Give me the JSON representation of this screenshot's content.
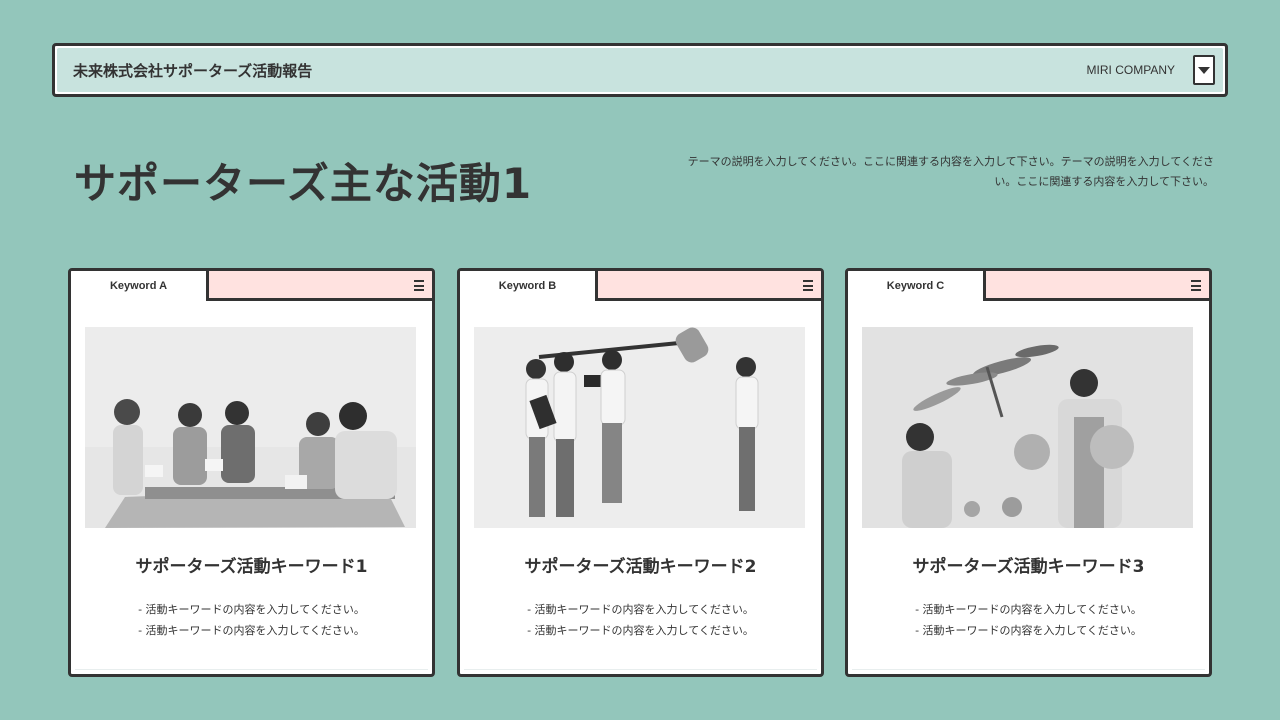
{
  "header": {
    "title": "未来株式会社サポーターズ活動報告",
    "company": "MIRI COMPANY"
  },
  "main": {
    "title": "サポーターズ主な活動1",
    "description": "テーマの説明を入力してください。ここに関連する内容を入力して下さい。テーマの説明を入力してください。ここに関連する内容を入力して下さい。"
  },
  "cards": [
    {
      "tab": "Keyword A",
      "heading": "サポーターズ活動キーワード1",
      "lines": [
        "- 活動キーワードの内容を入力してください。",
        "- 活動キーワードの内容を入力してください。"
      ]
    },
    {
      "tab": "Keyword B",
      "heading": "サポーターズ活動キーワード2",
      "lines": [
        "- 活動キーワードの内容を入力してください。",
        "- 活動キーワードの内容を入力してください。"
      ]
    },
    {
      "tab": "Keyword C",
      "heading": "サポーターズ活動キーワード3",
      "lines": [
        "- 活動キーワードの内容を入力してください。",
        "- 活動キーワードの内容を入力してください。"
      ]
    }
  ],
  "icons": {
    "header_dropdown": "caret-down-icon",
    "card_menu": "hamburger-menu-icon"
  },
  "colors": {
    "background": "#93c6bb",
    "header_fill": "#c8e3de",
    "tab_strip": "#ffe2e0",
    "border": "#333333"
  }
}
